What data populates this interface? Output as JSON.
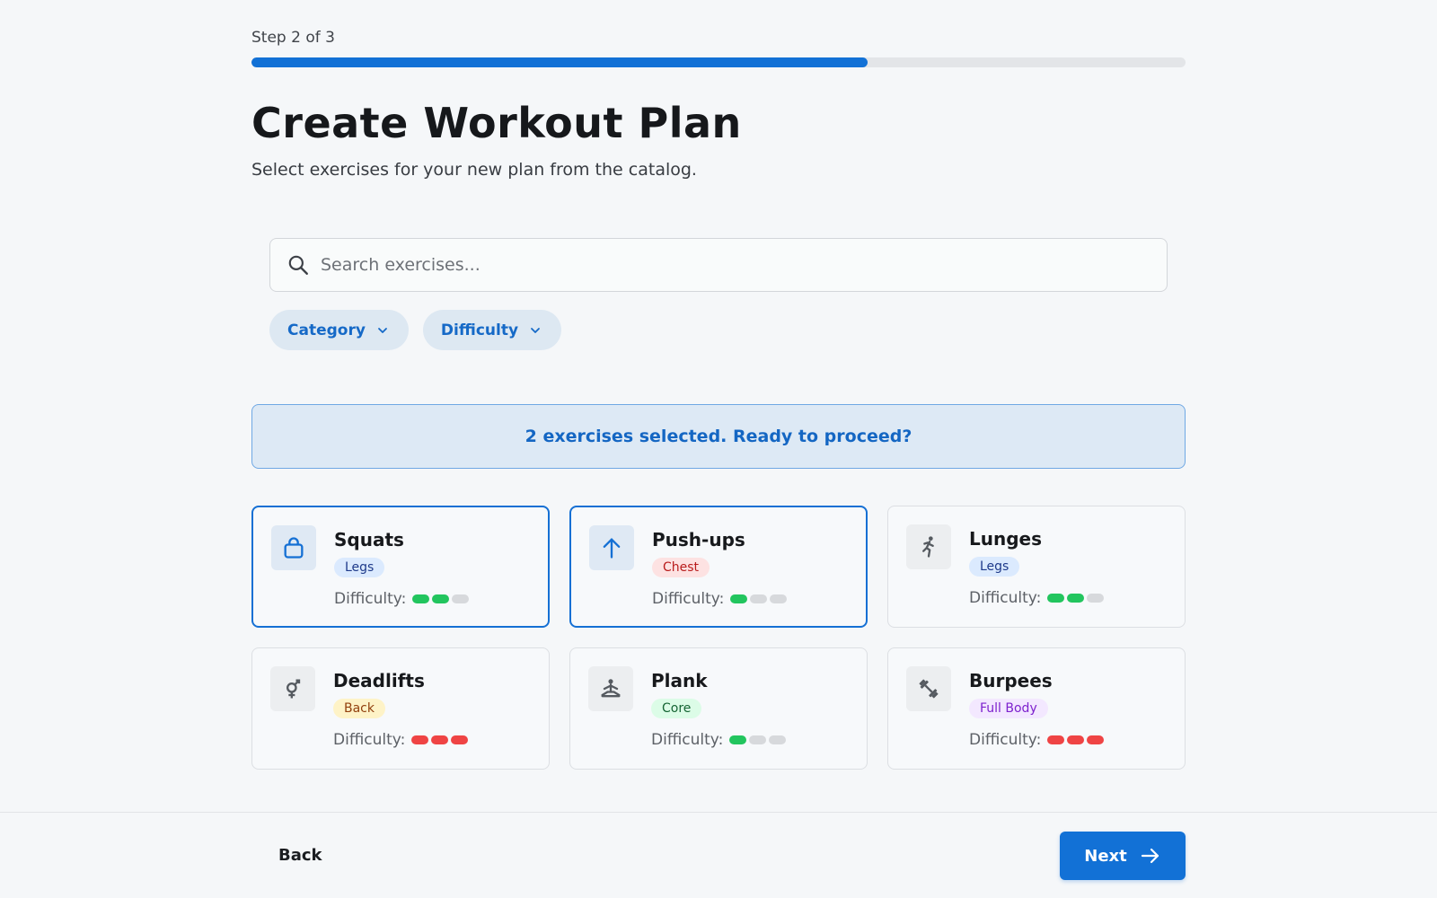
{
  "progress": {
    "label": "Step 2 of 3",
    "fraction": 0.66
  },
  "header": {
    "title": "Create Workout Plan",
    "subtitle": "Select exercises for your new plan from the catalog."
  },
  "search": {
    "placeholder": "Search exercises...",
    "value": "",
    "icon": "search-icon"
  },
  "filters": [
    {
      "label": "Category",
      "icon": "chevron-down-icon"
    },
    {
      "label": "Difficulty",
      "icon": "chevron-down-icon"
    }
  ],
  "banner": {
    "text": "2 exercises selected. Ready to proceed?"
  },
  "difficulty_label": "Difficulty:",
  "colors": {
    "accent": "#1271d6",
    "easy": "#22c55e",
    "hard": "#ef4444",
    "inactive": "#d7d9dc"
  },
  "exercises": [
    {
      "name": "Squats",
      "tag": "Legs",
      "tag_bg": "#dbeafe",
      "tag_color": "#1e3a8a",
      "level": 2,
      "level_color": "easy",
      "icon": "kettlebell-icon",
      "selected": true
    },
    {
      "name": "Push-ups",
      "tag": "Chest",
      "tag_bg": "#fde2e2",
      "tag_color": "#b91c1c",
      "level": 1,
      "level_color": "easy",
      "icon": "arrow-up-icon",
      "selected": true
    },
    {
      "name": "Lunges",
      "tag": "Legs",
      "tag_bg": "#dbeafe",
      "tag_color": "#1e3a8a",
      "level": 2,
      "level_color": "easy",
      "icon": "running-icon",
      "selected": false
    },
    {
      "name": "Deadlifts",
      "tag": "Back",
      "tag_bg": "#fef3c7",
      "tag_color": "#92400e",
      "level": 3,
      "level_color": "hard",
      "icon": "gender-icon",
      "selected": false
    },
    {
      "name": "Plank",
      "tag": "Core",
      "tag_bg": "#dcfce7",
      "tag_color": "#166534",
      "level": 1,
      "level_color": "easy",
      "icon": "meditation-icon",
      "selected": false
    },
    {
      "name": "Burpees",
      "tag": "Full Body",
      "tag_bg": "#f3e8ff",
      "tag_color": "#7e22ce",
      "level": 3,
      "level_color": "hard",
      "icon": "dumbbell-icon",
      "selected": false
    }
  ],
  "footer": {
    "back_label": "Back",
    "next_label": "Next",
    "next_icon": "arrow-right-icon"
  }
}
